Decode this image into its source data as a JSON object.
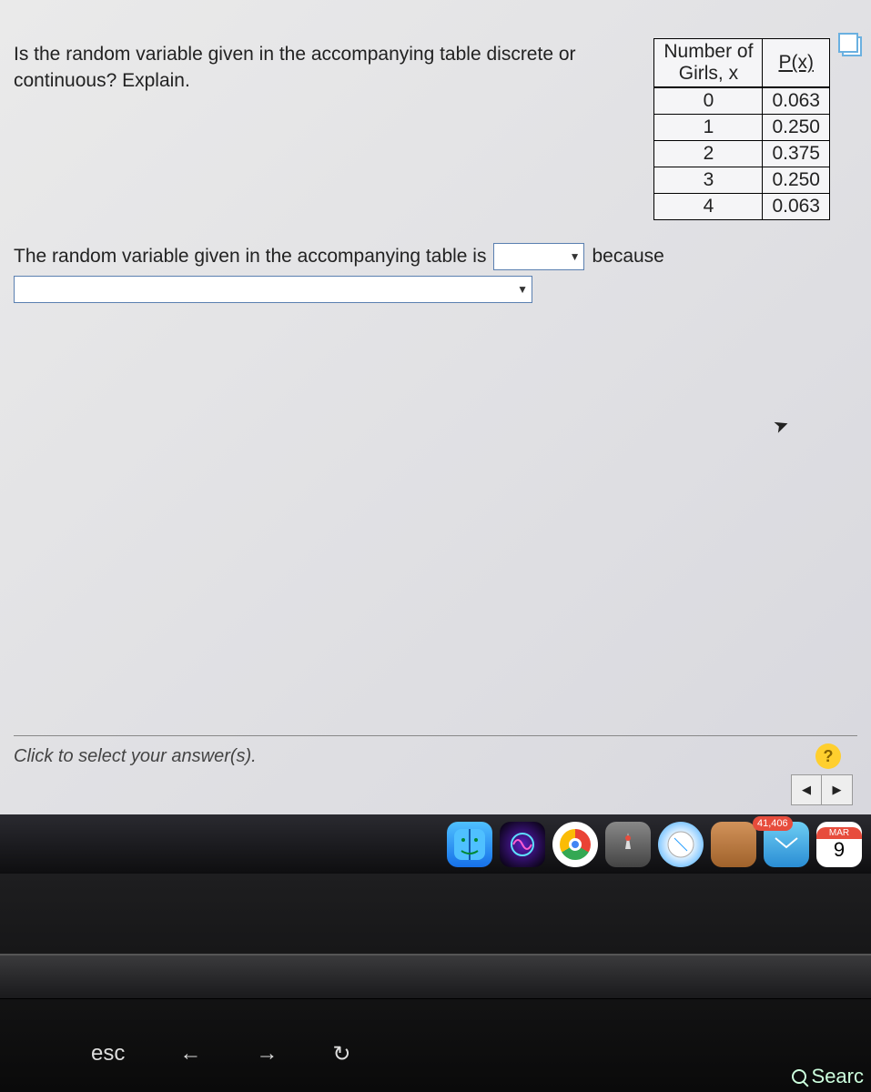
{
  "question": "Is the random variable given in the accompanying table discrete or continuous? Explain.",
  "table": {
    "header_x_line1": "Number of",
    "header_x_line2": "Girls, x",
    "header_px": "P(x)",
    "rows": [
      {
        "x": "0",
        "p": "0.063"
      },
      {
        "x": "1",
        "p": "0.250"
      },
      {
        "x": "2",
        "p": "0.375"
      },
      {
        "x": "3",
        "p": "0.250"
      },
      {
        "x": "4",
        "p": "0.063"
      }
    ]
  },
  "sentence": {
    "part1": "The random variable given in the accompanying table is",
    "part2": "because"
  },
  "footer_hint": "Click to select your answer(s).",
  "help_label": "?",
  "nav_prev": "◀",
  "nav_next": "▶",
  "dock": {
    "mail_badge": "41,406",
    "cal_month": "MAR",
    "cal_day": "9"
  },
  "keyboard": {
    "esc": "esc",
    "back": "←",
    "forward": "→",
    "reload": "↻",
    "search_stub": "Searc"
  }
}
